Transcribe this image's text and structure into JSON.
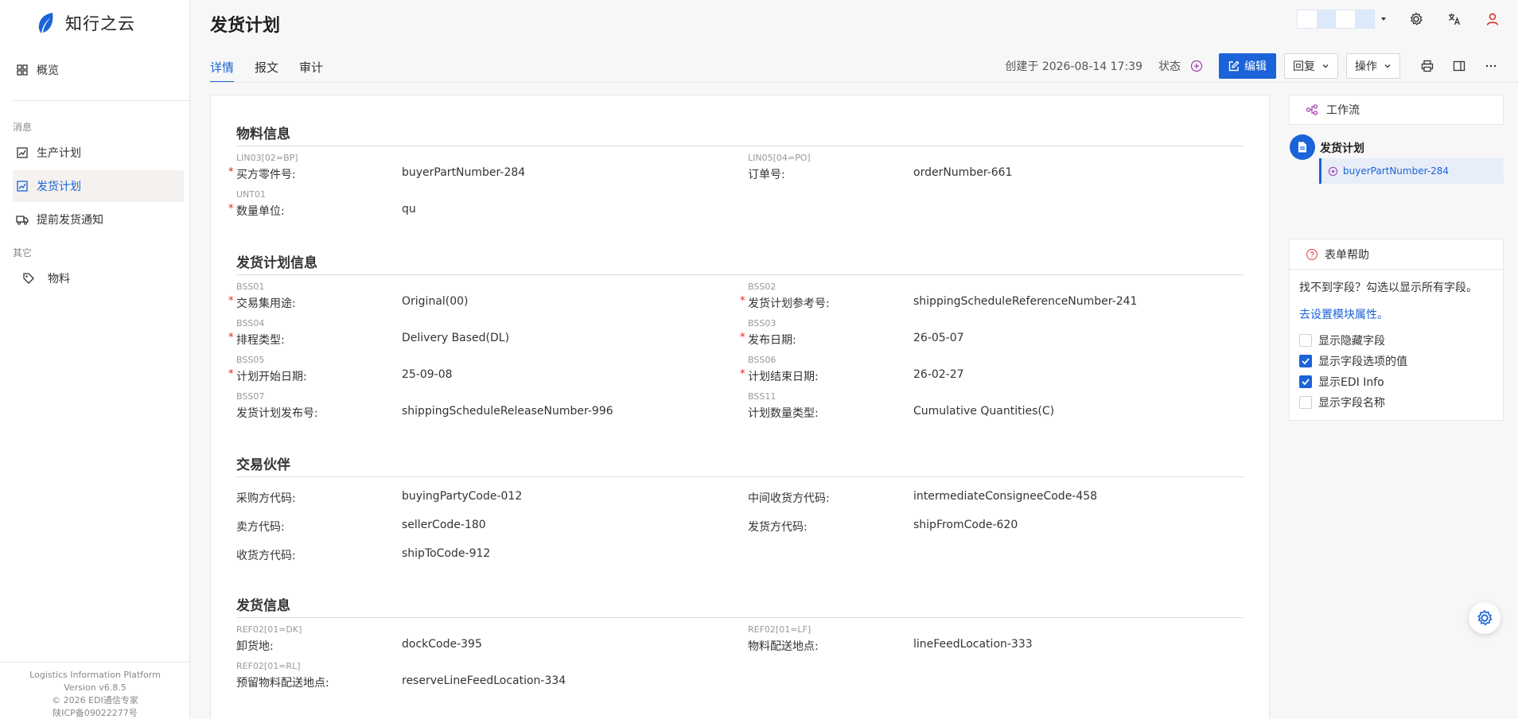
{
  "brand": {
    "name": "知行之云"
  },
  "sidebar": {
    "overview": "概览",
    "group_messages": "消息",
    "items": [
      {
        "label": "生产计划",
        "active": false
      },
      {
        "label": "发货计划",
        "active": true
      },
      {
        "label": "提前发货通知",
        "active": false
      }
    ],
    "group_other": "其它",
    "other_items": [
      {
        "label": "物料"
      }
    ],
    "footer": {
      "platform": "Logistics Information Platform",
      "version": "Version v6.8.5",
      "copyright": "© 2026 EDI通信专家",
      "icp": "陕ICP备09022277号"
    }
  },
  "header": {
    "title": "发货计划"
  },
  "tabs": [
    {
      "label": "详情",
      "active": true
    },
    {
      "label": "报文",
      "active": false
    },
    {
      "label": "审计",
      "active": false
    }
  ],
  "toolbar": {
    "created": "创建于 2026-08-14 17:39",
    "status_label": "状态",
    "edit": "编辑",
    "reply": "回复",
    "action": "操作"
  },
  "sections": [
    {
      "title": "物料信息",
      "fields": [
        {
          "edi": "LIN03[02=BP]",
          "label": "买方零件号:",
          "value": "buyerPartNumber-284",
          "required": true
        },
        {
          "edi": "LIN05[04=PO]",
          "label": "订单号:",
          "value": "orderNumber-661",
          "required": false
        },
        {
          "edi": "UNT01",
          "label": "数量单位:",
          "value": "qu",
          "required": true
        }
      ]
    },
    {
      "title": "发货计划信息",
      "fields": [
        {
          "edi": "BSS01",
          "label": "交易集用途:",
          "value": "Original(00)",
          "required": true
        },
        {
          "edi": "BSS02",
          "label": "发货计划参考号:",
          "value": "shippingScheduleReferenceNumber-241",
          "required": true
        },
        {
          "edi": "BSS04",
          "label": "排程类型:",
          "value": "Delivery Based(DL)",
          "required": true
        },
        {
          "edi": "BSS03",
          "label": "发布日期:",
          "value": "26-05-07",
          "required": true
        },
        {
          "edi": "BSS05",
          "label": "计划开始日期:",
          "value": "25-09-08",
          "required": true
        },
        {
          "edi": "BSS06",
          "label": "计划结束日期:",
          "value": "26-02-27",
          "required": true
        },
        {
          "edi": "BSS07",
          "label": "发货计划发布号:",
          "value": "shippingScheduleReleaseNumber-996",
          "required": false
        },
        {
          "edi": "BSS11",
          "label": "计划数量类型:",
          "value": "Cumulative Quantities(C)",
          "required": false
        }
      ]
    },
    {
      "title": "交易伙伴",
      "fields": [
        {
          "edi": "",
          "label": "采购方代码:",
          "value": "buyingPartyCode-012",
          "required": false
        },
        {
          "edi": "",
          "label": "中间收货方代码:",
          "value": "intermediateConsigneeCode-458",
          "required": false
        },
        {
          "edi": "",
          "label": "卖方代码:",
          "value": "sellerCode-180",
          "required": false
        },
        {
          "edi": "",
          "label": "发货方代码:",
          "value": "shipFromCode-620",
          "required": false
        },
        {
          "edi": "",
          "label": "收货方代码:",
          "value": "shipToCode-912",
          "required": false
        }
      ]
    },
    {
      "title": "发货信息",
      "fields": [
        {
          "edi": "REF02[01=DK]",
          "label": "卸货地:",
          "value": "dockCode-395",
          "required": false
        },
        {
          "edi": "REF02[01=LF]",
          "label": "物料配送地点:",
          "value": "lineFeedLocation-333",
          "required": false
        },
        {
          "edi": "REF02[01=RL]",
          "label": "预留物料配送地点:",
          "value": "reserveLineFeedLocation-334",
          "required": false
        }
      ]
    }
  ],
  "workflow": {
    "title": "工作流",
    "node_title": "发货计划",
    "node_sub": "buyerPartNumber-284"
  },
  "help": {
    "title": "表单帮助",
    "text": "找不到字段？勾选以显示所有字段。",
    "link": "去设置模块属性。",
    "options": [
      {
        "label": "显示隐藏字段",
        "checked": false
      },
      {
        "label": "显示字段选项的值",
        "checked": true
      },
      {
        "label": "显示EDI Info",
        "checked": true
      },
      {
        "label": "显示字段名称",
        "checked": false
      }
    ]
  },
  "colors": {
    "primary": "#1a63d8",
    "required": "#e02020",
    "active_nav_bg": "#f5f1ee"
  }
}
